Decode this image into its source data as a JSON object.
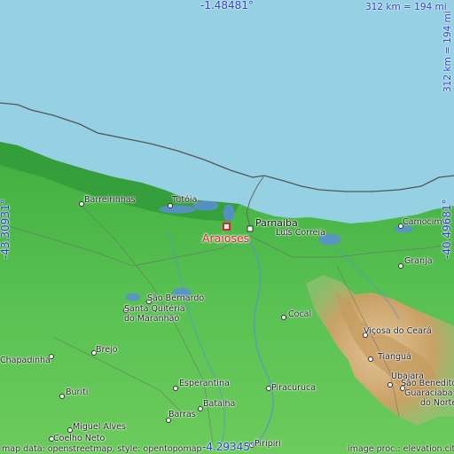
{
  "map": {
    "coords": {
      "top": "-1.48481°",
      "bottom": "-4.29345°",
      "left": "-43.30931°",
      "right": "-40.49681°"
    },
    "scale": {
      "top": "312 km = 194 mi",
      "right": "312 km = 194 mi"
    },
    "highlight": {
      "name": "Araioses",
      "color": "#e0202a"
    },
    "places": {
      "parnaiba": "Parnaíba",
      "barreirinhas": "Barreirinhas",
      "tutoia": "Tutóia",
      "luis_correia": "Luís Correia",
      "camocim": "Camocim",
      "granja": "Granja",
      "sao_bernardo": "São Bernardo",
      "santa_quiteria": "Santa Quitéria",
      "do_maranhao": "do Maranhão",
      "cocal": "Cocal",
      "vicosa": "Viçosa do Ceará",
      "chapadinha": "Chapadinha",
      "brejo": "Brejo",
      "tiangua": "Tianguá",
      "ubajara": "Ubajara",
      "buriti": "Buriti",
      "esperantina": "Esperantina",
      "piracuruca": "Piracuruca",
      "sao_benedito": "São Benedito",
      "guaraciaba": "Guaraciaba",
      "do_norte": "do Norte",
      "batalha": "Batalha",
      "miguel_alves": "Miguel Alves",
      "coelho_neto": "Coelho Neto",
      "barras": "Barras",
      "piripiri": "Piripiri"
    },
    "credits": {
      "left": "map data: openstreetmap, style: opentopomap",
      "right": "image proc.: elevation.city"
    },
    "colors": {
      "sea": "#95d1e3",
      "lowland": "#4fbf4c",
      "hills": "#d8b57c",
      "water": "#5a8fd6",
      "coastline": "#555555"
    }
  }
}
